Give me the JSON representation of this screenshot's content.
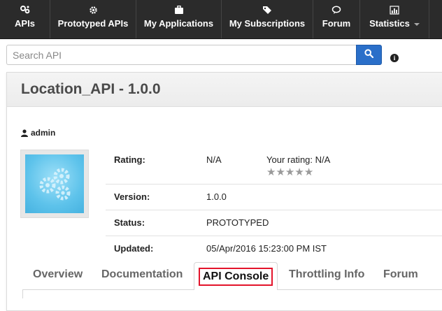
{
  "nav": {
    "items": [
      {
        "label": "APIs",
        "icon": "gears-icon"
      },
      {
        "label": "Prototyped APIs",
        "icon": "gear-icon"
      },
      {
        "label": "My Applications",
        "icon": "briefcase-icon"
      },
      {
        "label": "My Subscriptions",
        "icon": "tags-icon"
      },
      {
        "label": "Forum",
        "icon": "comment-icon"
      },
      {
        "label": "Statistics",
        "icon": "bar-chart-icon"
      }
    ]
  },
  "search": {
    "placeholder": "Search API",
    "value": ""
  },
  "api": {
    "title": "Location_API - 1.0.0",
    "owner": "admin",
    "rating_label": "Rating:",
    "rating_value": "N/A",
    "your_rating_label": "Your rating:",
    "your_rating_value": "N/A",
    "star_count": 5,
    "version_label": "Version:",
    "version_value": "1.0.0",
    "status_label": "Status:",
    "status_value": "PROTOTYPED",
    "updated_label": "Updated:",
    "updated_value": "05/Apr/2016 15:23:00 PM IST"
  },
  "tabs": [
    {
      "label": "Overview"
    },
    {
      "label": "Documentation"
    },
    {
      "label": "API Console"
    },
    {
      "label": "Throttling Info"
    },
    {
      "label": "Forum"
    }
  ],
  "colors": {
    "nav_bg": "#2b2b2b",
    "search_button": "#2a6fc9",
    "highlight": "#e3142b",
    "thumb": "#5ec3eb"
  }
}
